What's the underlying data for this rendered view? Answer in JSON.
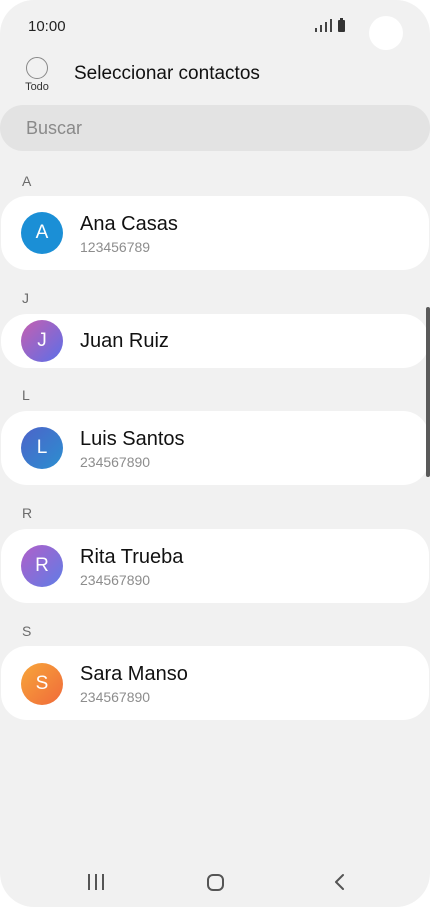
{
  "status_bar": {
    "time": "10:00"
  },
  "header": {
    "select_all_label": "Todo",
    "title": "Seleccionar contactos"
  },
  "search": {
    "placeholder": "Buscar"
  },
  "sections": [
    {
      "letter": "A",
      "contact": {
        "initial": "A",
        "name": "Ana Casas",
        "number": "123456789"
      }
    },
    {
      "letter": "J",
      "contact": {
        "initial": "J",
        "name": "Juan Ruiz",
        "number": ""
      }
    },
    {
      "letter": "L",
      "contact": {
        "initial": "L",
        "name": "Luis Santos",
        "number": "234567890"
      }
    },
    {
      "letter": "R",
      "contact": {
        "initial": "R",
        "name": "Rita Trueba",
        "number": "234567890"
      }
    },
    {
      "letter": "S",
      "contact": {
        "initial": "S",
        "name": "Sara Manso",
        "number": "234567890"
      }
    }
  ],
  "colors": {
    "background": "#f1f1f1",
    "card": "#ffffff",
    "avatar_a": "#1b8fd6",
    "avatar_j": "#8a5fe0",
    "avatar_l": "#3a78c9",
    "avatar_r": "#8d63d8",
    "avatar_s": "#f2843a"
  },
  "nav": {
    "icons": [
      "recent-apps-icon",
      "home-icon",
      "back-icon"
    ]
  }
}
